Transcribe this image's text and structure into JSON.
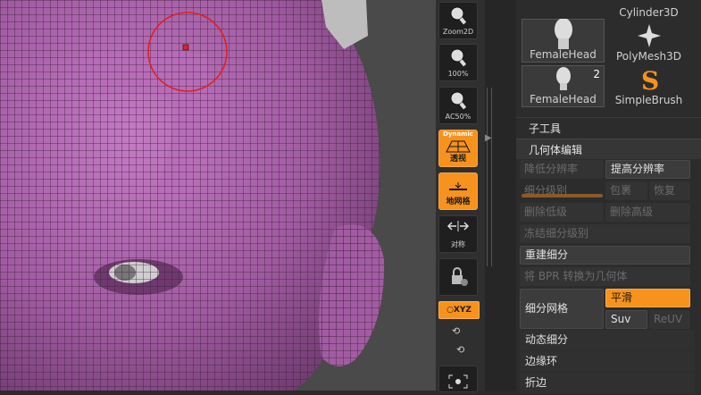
{
  "toolbar": {
    "zoom2d_label": "Zoom2D",
    "actual_label": "100%",
    "ac50_label": "AC50%",
    "persp_top": "Dynamic",
    "persp_label": "透视",
    "floor_label": "地网格",
    "sym_label": "对称",
    "xyz_label": "○XYZ"
  },
  "tools": [
    {
      "name": "FemaleHead",
      "badge": ""
    },
    {
      "name": "Cylinder3D",
      "badge": ""
    },
    {
      "name": "FemaleHead",
      "badge": "2"
    },
    {
      "name": "PolyMesh3D",
      "badge": ""
    },
    {
      "name": "SimpleBrush",
      "badge": ""
    }
  ],
  "subtool_title": "子工具",
  "geometry": {
    "title": "几何体编辑",
    "lower_res": "降低分辨率",
    "higher_res": "提高分辨率",
    "sdiv": "细分级别",
    "reconstruct": "包裹",
    "restore": "恢复",
    "del_lower": "删除低级",
    "del_higher": "删除高级",
    "freeze": "冻结细分级别",
    "rebuild": "重建细分",
    "bpr": "将 BPR 转换为几何体",
    "divide": "细分网格",
    "smooth": "平滑",
    "suv": "Suv",
    "reuv": "ReUV",
    "dynamic_sub": "动态细分",
    "edge_loop": "边缘环",
    "crease": "折边"
  },
  "colors": {
    "accent": "#f7921d",
    "mesh": "#a45aa4"
  }
}
